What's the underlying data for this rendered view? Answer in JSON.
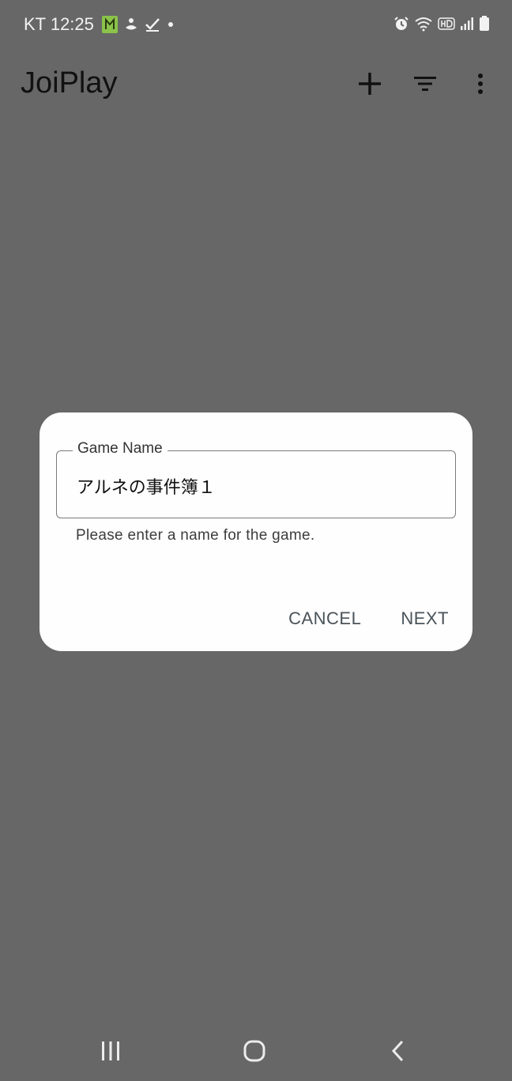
{
  "status_bar": {
    "time": "KT 12:25",
    "notification_icons": [
      "app-notification-icon",
      "swan-icon",
      "check-icon",
      "dot-icon"
    ],
    "system_icons": [
      "alarm-icon",
      "wifi-icon",
      "hd-icon",
      "signal-icon",
      "battery-icon"
    ]
  },
  "app_bar": {
    "title": "JoiPlay",
    "actions": [
      "add-icon",
      "filter-icon",
      "more-vert-icon"
    ]
  },
  "dialog": {
    "field_label": "Game Name",
    "field_value": "アルネの事件簿１",
    "helper_text": "Please enter a name for the game.",
    "cancel_label": "CANCEL",
    "next_label": "NEXT"
  },
  "colors": {
    "scrim": "#676767",
    "dialog_bg": "#fefefe",
    "button_text": "#4a5359",
    "notification_green": "#8bc34a"
  },
  "nav_bar": {
    "buttons": [
      "recents-icon",
      "home-icon",
      "back-icon"
    ]
  }
}
